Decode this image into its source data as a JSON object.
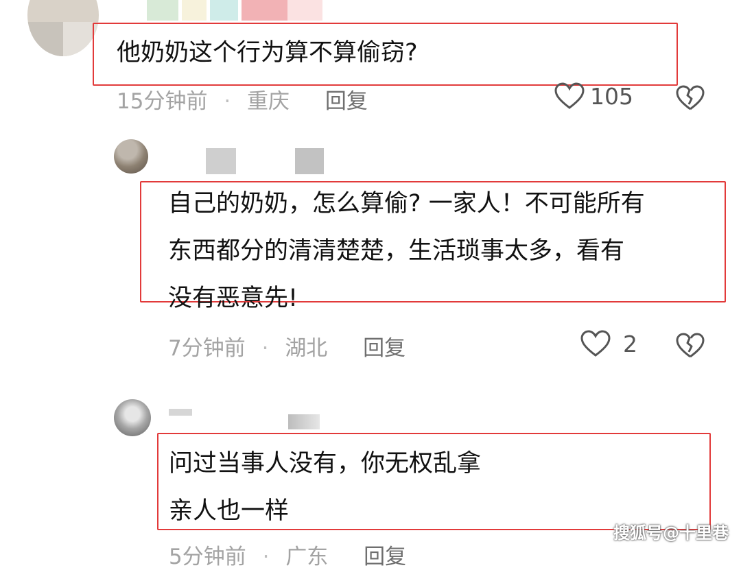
{
  "comments": [
    {
      "text_lines": [
        "他奶奶这个行为算不算偷窃?"
      ],
      "time": "15分钟前",
      "location": "重庆",
      "reply_label": "回复",
      "likes": "105"
    },
    {
      "text_lines": [
        "自己的奶奶，怎么算偷? 一家人！不可能所有",
        "东西都分的清清楚楚，生活琐事太多，看有",
        "没有恶意先!"
      ],
      "time": "7分钟前",
      "location": "湖北",
      "reply_label": "回复",
      "likes": "2"
    },
    {
      "text_lines": [
        "问过当事人没有，你无权乱拿",
        "亲人也一样"
      ],
      "time": "5分钟前",
      "location": "广东",
      "reply_label": "回复"
    }
  ],
  "separator": "·",
  "watermark": "搜狐号@十里巷",
  "colors": {
    "highlight_border": "#e23a3a",
    "text": "#111111",
    "meta": "#a3a3a3"
  },
  "icons": [
    "heart-icon",
    "broken-heart-icon"
  ]
}
